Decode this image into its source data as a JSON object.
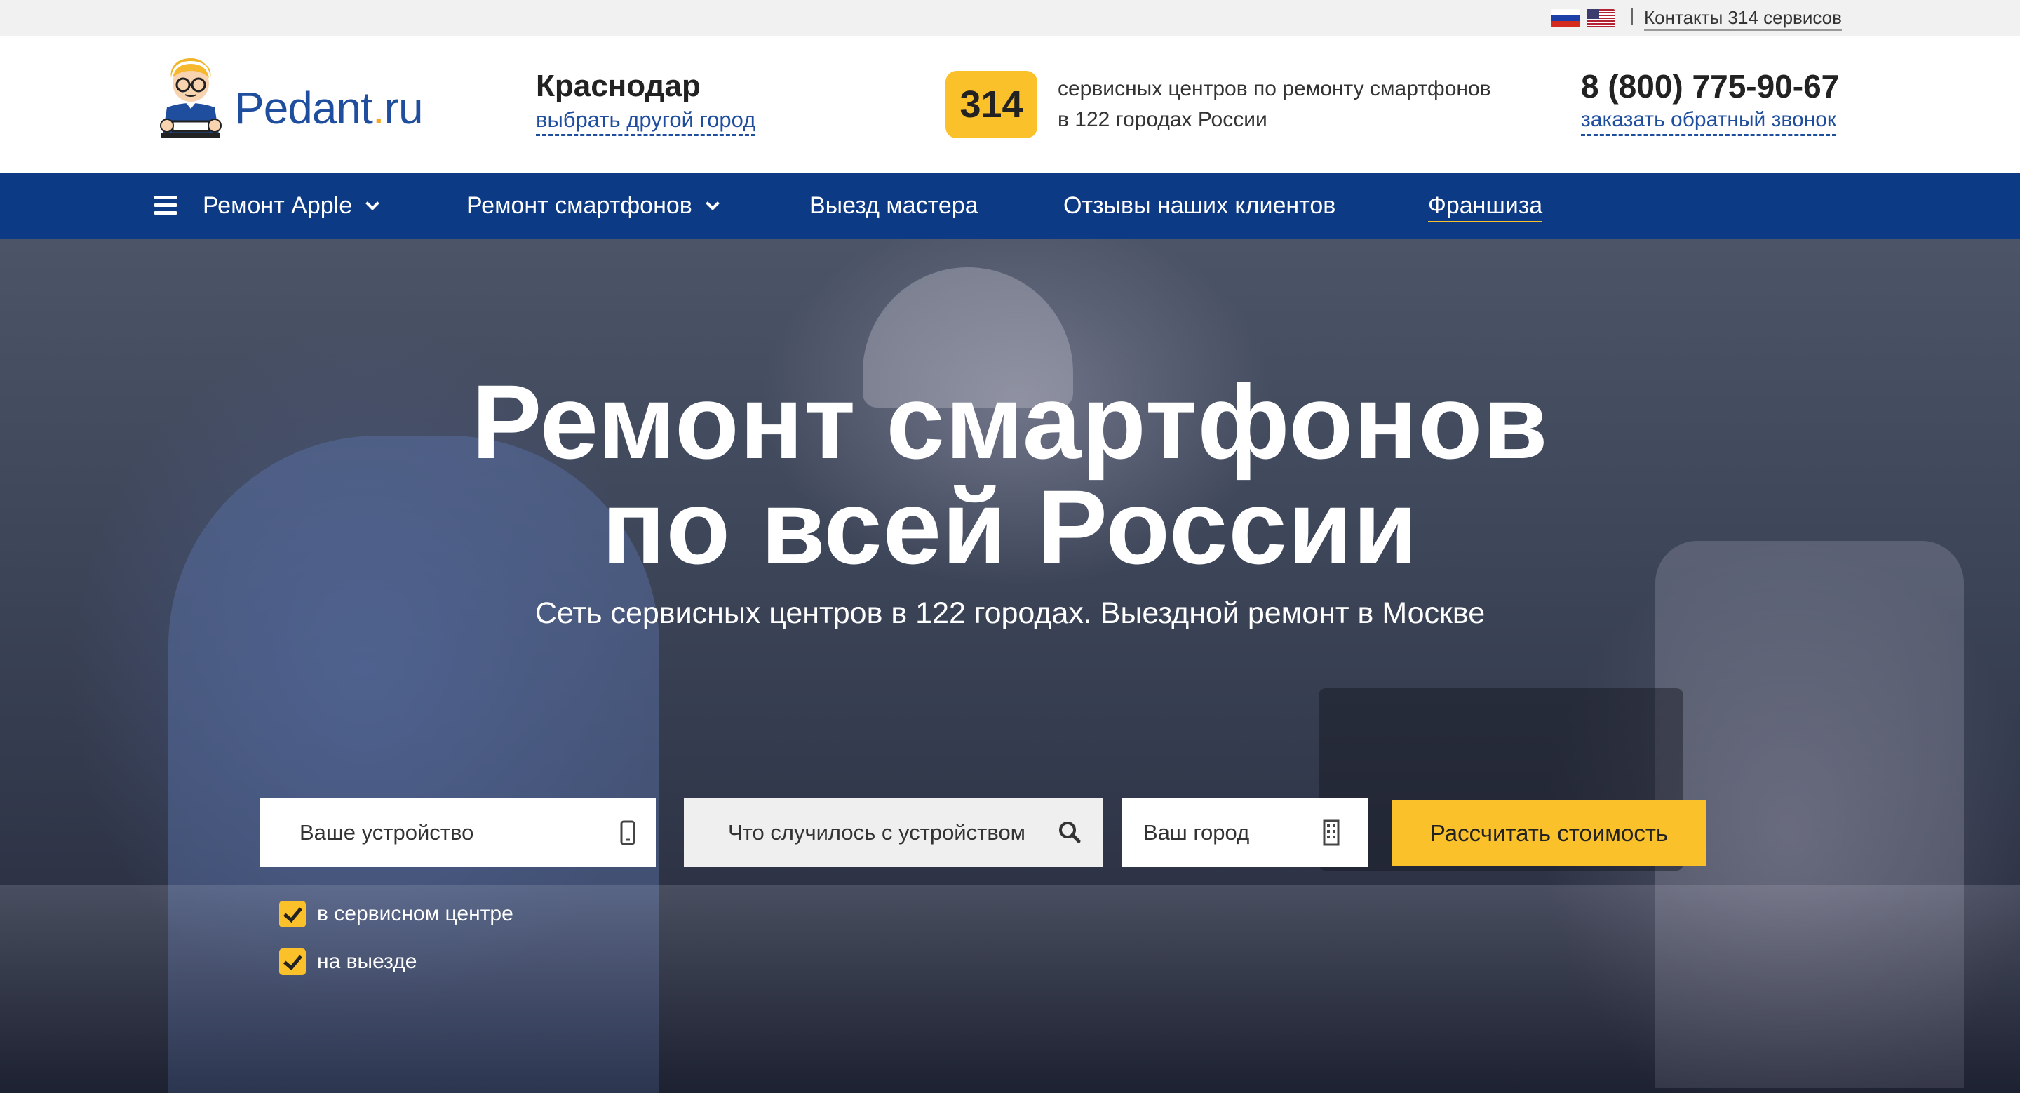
{
  "topbar": {
    "flags": [
      "flag-ru-icon",
      "flag-us-icon"
    ],
    "contacts_link": "Контакты 314 сервисов"
  },
  "header": {
    "logo": {
      "text_main": "Pedant",
      "text_dot": ".",
      "text_tld": "ru",
      "mascot": "pedant-mascot-icon"
    },
    "city": "Краснодар",
    "city_change": "выбрать другой город",
    "service_count": "314",
    "service_text_line1": "сервисных центров по ремонту смартфонов",
    "service_text_line2": "в 122 городах России",
    "phone": "8 (800) 775-90-67",
    "callback": "заказать обратный звонок"
  },
  "nav": {
    "items": [
      {
        "label": "Ремонт Apple",
        "dropdown": true
      },
      {
        "label": "Ремонт смартфонов",
        "dropdown": true
      },
      {
        "label": "Выезд мастера"
      },
      {
        "label": "Отзывы наших клиентов"
      },
      {
        "label": "Франшиза"
      }
    ]
  },
  "hero": {
    "title_line1": "Ремонт смартфонов",
    "title_line2": "по всей России",
    "subtitle": "Сеть сервисных центров в 122 городах. Выездной ремонт в Москве",
    "form": {
      "device_placeholder": "Ваше устройство",
      "problem_placeholder": "Что случилось с устройством",
      "city_placeholder": "Ваш город",
      "submit": "Рассчитать стоимость"
    },
    "options": [
      {
        "label": "в сервисном центре",
        "checked": true
      },
      {
        "label": "на выезде",
        "checked": true
      }
    ]
  },
  "colors": {
    "brand_blue": "#0d3a85",
    "accent_yellow": "#fbc12b",
    "link_blue": "#1f4e9e"
  }
}
